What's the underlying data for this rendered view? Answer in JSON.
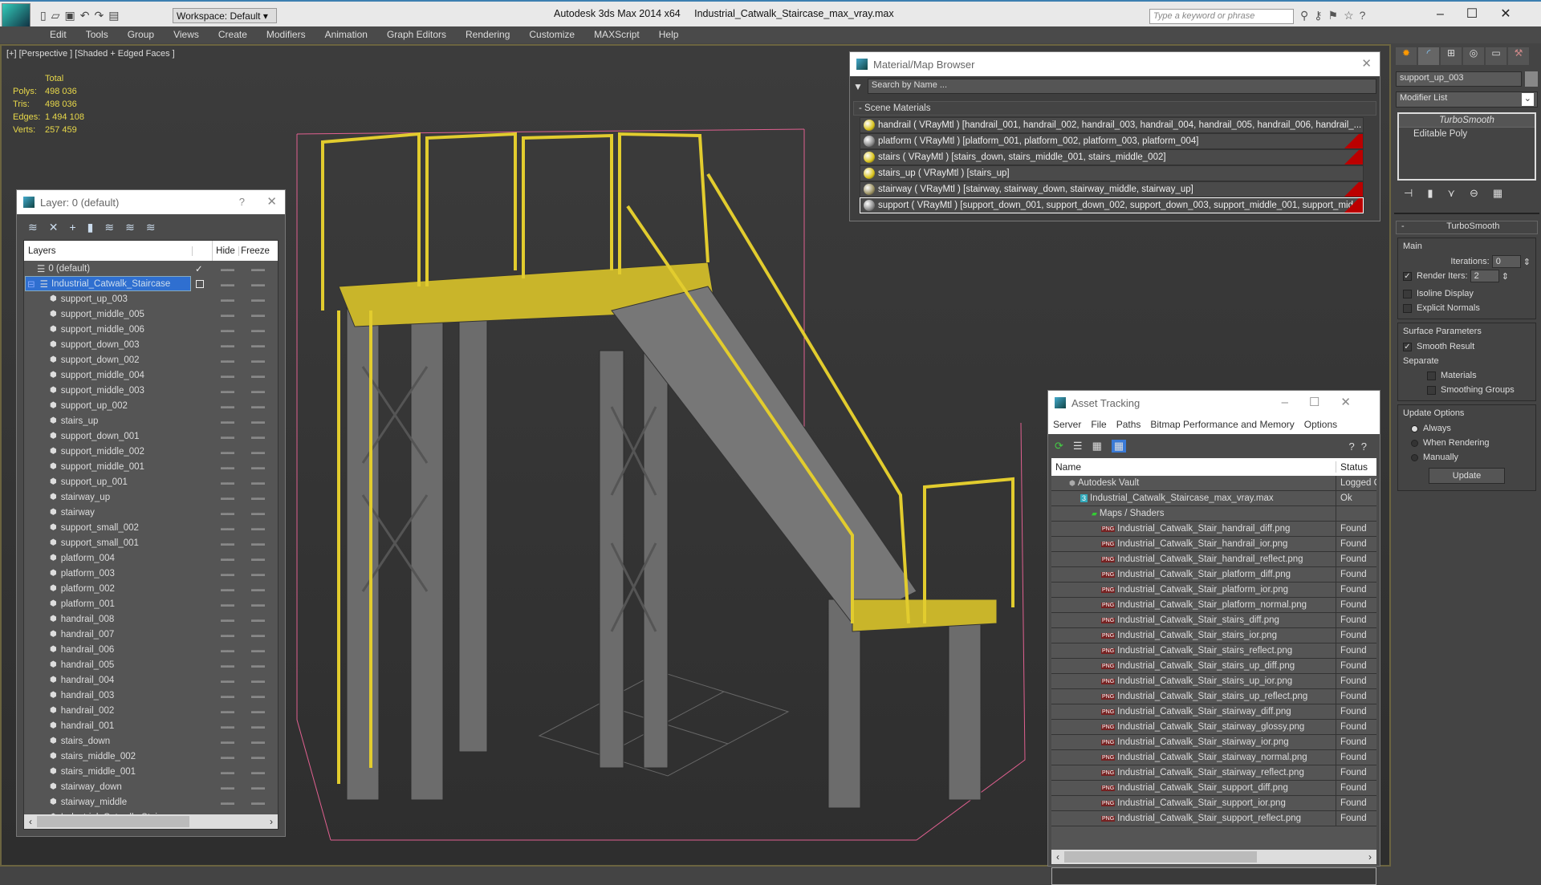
{
  "app": {
    "title": "Autodesk 3ds Max  2014 x64",
    "file": "Industrial_Catwalk_Staircase_max_vray.max",
    "workspace": "Workspace: Default",
    "search_placeholder": "Type a keyword or phrase"
  },
  "menu": [
    "Edit",
    "Tools",
    "Group",
    "Views",
    "Create",
    "Modifiers",
    "Animation",
    "Graph Editors",
    "Rendering",
    "Customize",
    "MAXScript",
    "Help"
  ],
  "viewport": {
    "label": "[+] [Perspective ] [Shaded + Edged Faces ]",
    "stats_header": "Total",
    "stats": [
      {
        "label": "Polys:",
        "value": "498 036"
      },
      {
        "label": "Tris:",
        "value": "498 036"
      },
      {
        "label": "Edges:",
        "value": "1 494 108"
      },
      {
        "label": "Verts:",
        "value": "257 459"
      }
    ]
  },
  "layer_dialog": {
    "title": "Layer: 0 (default)",
    "help": "?",
    "col_layers": "Layers",
    "col_hide": "Hide",
    "col_freeze": "Freeze",
    "default_layer": "0 (default)",
    "active_layer": "Industrial_Catwalk_Staircase",
    "objects": [
      "support_up_003",
      "support_middle_005",
      "support_middle_006",
      "support_down_003",
      "support_down_002",
      "support_middle_004",
      "support_middle_003",
      "support_up_002",
      "stairs_up",
      "support_down_001",
      "support_middle_002",
      "support_middle_001",
      "support_up_001",
      "stairway_up",
      "stairway",
      "support_small_002",
      "support_small_001",
      "platform_004",
      "platform_003",
      "platform_002",
      "platform_001",
      "handrail_008",
      "handrail_007",
      "handrail_006",
      "handrail_005",
      "handrail_004",
      "handrail_003",
      "handrail_002",
      "handrail_001",
      "stairs_down",
      "stairs_middle_002",
      "stairs_middle_001",
      "stairway_down",
      "stairway_middle",
      "Industrial_Catwalk_Staircase"
    ]
  },
  "material_browser": {
    "title": "Material/Map Browser",
    "search_placeholder": "Search by Name ...",
    "section": "- Scene Materials",
    "materials": [
      {
        "text": "handrail  ( VRayMtl )  [handrail_001, handrail_002, handrail_003, handrail_004, handrail_005, handrail_006, handrail_...",
        "color": "#d8c21a",
        "flag": false
      },
      {
        "text": "platform  ( VRayMtl )  [platform_001, platform_002, platform_003, platform_004]",
        "color": "#8a8a8a",
        "flag": true
      },
      {
        "text": "stairs  ( VRayMtl ) [stairs_down, stairs_middle_001, stairs_middle_002]",
        "color": "#d8c21a",
        "flag": true
      },
      {
        "text": "stairs_up  ( VRayMtl )  [stairs_up]",
        "color": "#d8c21a",
        "flag": false
      },
      {
        "text": "stairway  ( VRayMtl )  [stairway, stairway_down, stairway_middle, stairway_up]",
        "color": "#9a9060",
        "flag": true
      },
      {
        "text": "support ( VRayMtl ) [support_down_001, support_down_002, support_down_003, support_middle_001, support_mid...",
        "color": "#8a8a8a",
        "flag": true
      }
    ]
  },
  "asset_tracking": {
    "title": "Asset Tracking",
    "menu": [
      "Server",
      "File",
      "Paths",
      "Bitmap Performance and Memory",
      "Options"
    ],
    "col_name": "Name",
    "col_status": "Status",
    "vault": {
      "name": "Autodesk Vault",
      "status": "Logged C"
    },
    "file": {
      "name": "Industrial_Catwalk_Staircase_max_vray.max",
      "status": "Ok"
    },
    "maps_group": "Maps / Shaders",
    "maps": [
      "Industrial_Catwalk_Stair_handrail_diff.png",
      "Industrial_Catwalk_Stair_handrail_ior.png",
      "Industrial_Catwalk_Stair_handrail_reflect.png",
      "Industrial_Catwalk_Stair_platform_diff.png",
      "Industrial_Catwalk_Stair_platform_ior.png",
      "Industrial_Catwalk_Stair_platform_normal.png",
      "Industrial_Catwalk_Stair_stairs_diff.png",
      "Industrial_Catwalk_Stair_stairs_ior.png",
      "Industrial_Catwalk_Stair_stairs_reflect.png",
      "Industrial_Catwalk_Stair_stairs_up_diff.png",
      "Industrial_Catwalk_Stair_stairs_up_ior.png",
      "Industrial_Catwalk_Stair_stairs_up_reflect.png",
      "Industrial_Catwalk_Stair_stairway_diff.png",
      "Industrial_Catwalk_Stair_stairway_glossy.png",
      "Industrial_Catwalk_Stair_stairway_ior.png",
      "Industrial_Catwalk_Stair_stairway_normal.png",
      "Industrial_Catwalk_Stair_stairway_reflect.png",
      "Industrial_Catwalk_Stair_support_diff.png",
      "Industrial_Catwalk_Stair_support_ior.png",
      "Industrial_Catwalk_Stair_support_reflect.png"
    ],
    "map_status": "Found",
    "png_badge": "PNG"
  },
  "command_panel": {
    "object_name": "support_up_003",
    "modifier_list": "Modifier List",
    "stack": [
      "TurboSmooth",
      "Editable Poly"
    ],
    "rollout": "TurboSmooth",
    "rollout_toggle": "-",
    "main": "Main",
    "iterations_label": "Iterations:",
    "iterations": "0",
    "render_iters_label": "Render Iters:",
    "render_iters": "2",
    "isoline": "Isoline Display",
    "explicit_normals": "Explicit Normals",
    "surface_params": "Surface Parameters",
    "smooth_result": "Smooth Result",
    "separate": "Separate",
    "materials": "Materials",
    "smoothing_groups": "Smoothing Groups",
    "update_options": "Update Options",
    "always": "Always",
    "when_rendering": "When Rendering",
    "manually": "Manually",
    "update": "Update"
  }
}
